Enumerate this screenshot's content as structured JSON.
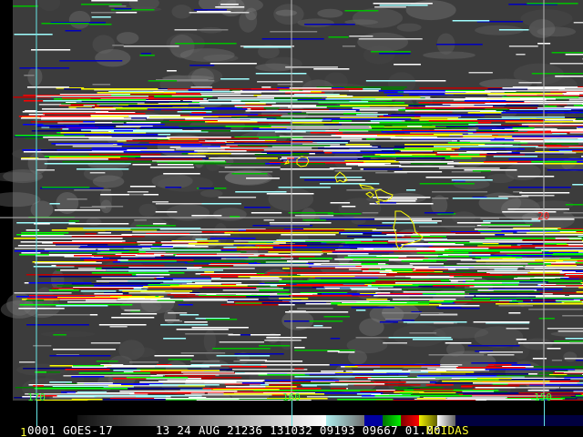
{
  "image": {
    "satellite": "GOES-17",
    "frame_number": "1",
    "status_fields": [
      "0001",
      "GOES-17",
      "13",
      "24",
      "AUG",
      "21236",
      "131032",
      "09193",
      "09667",
      "01.00"
    ],
    "status_line": "0001 GOES-17      13 24 AUG 21236 131032 09193 09667 01.00",
    "software_label": "McIDAS"
  },
  "grid": {
    "longitude_labels": [
      "170",
      "160",
      "150"
    ],
    "latitude_labels": [
      "20"
    ],
    "grid_color": "#66e6e6",
    "lon_label_color": "#33ff33",
    "lat_label_color": "#ff2020",
    "coastline_color": "#ffff00"
  },
  "colorbar": {
    "segments": [
      "#202020",
      "#ffffff",
      "#aeeeee",
      "#0000a0",
      "#00c000",
      "#c00000",
      "#e0e000",
      "#f0f0f0",
      "#000040"
    ]
  }
}
